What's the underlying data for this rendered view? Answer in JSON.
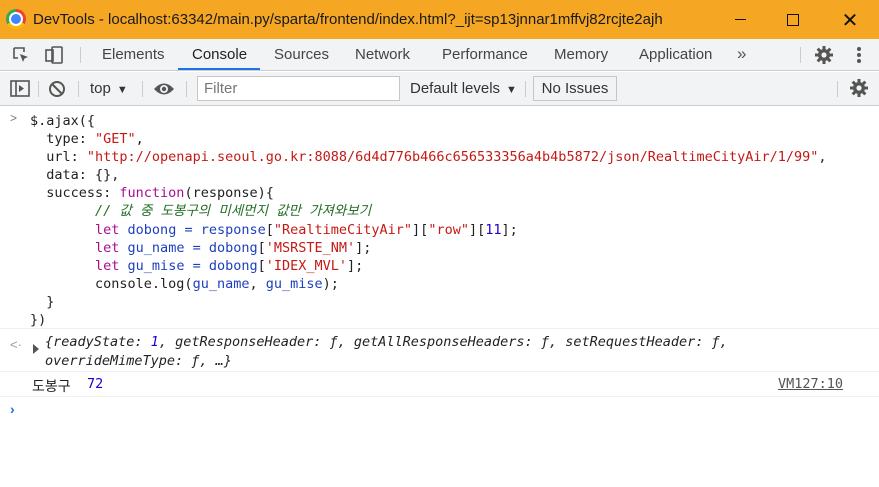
{
  "window": {
    "title": "DevTools - localhost:63342/main.py/sparta/frontend/index.html?_ijt=sp13jnnar1mffvj82rcjte2ajh",
    "accent_color": "#f5a623"
  },
  "tabs": {
    "items": [
      {
        "label": "Elements"
      },
      {
        "label": "Console"
      },
      {
        "label": "Sources"
      },
      {
        "label": "Network"
      },
      {
        "label": "Performance"
      },
      {
        "label": "Memory"
      },
      {
        "label": "Application"
      }
    ],
    "active": "Console",
    "more": "»"
  },
  "toolbar": {
    "context": "top",
    "filter_placeholder": "Filter",
    "levels": "Default levels",
    "issues": "No Issues"
  },
  "console": {
    "code": {
      "line1": "$.ajax({",
      "type_key": "  type: ",
      "type_val": "\"GET\"",
      "url_key": "  url: ",
      "url_val": "\"http://openapi.seoul.go.kr:8088/6d4d776b466c656533356a4b4b5872/json/RealtimeCityAir/1/99\"",
      "data_line": "  data: {},",
      "success_key": "  success: ",
      "success_fn": "function",
      "success_param": "(response){",
      "comment": "// 값 중 도봉구의 미세먼지 값만 가져와보기",
      "l1_kw": "let",
      "l1_var": " dobong = ",
      "l1_ref": "response",
      "l1_s1": "\"RealtimeCityAir\"",
      "l1_s2": "\"row\"",
      "l1_idx": "11",
      "l2_kw": "let",
      "l2_var": " gu_name = ",
      "l2_ref": "dobong",
      "l2_s": "'MSRSTE_NM'",
      "l3_kw": "let",
      "l3_var": " gu_mise = ",
      "l3_ref": "dobong",
      "l3_s": "'IDEX_MVL'",
      "l4": "console.log(",
      "l4_a": "gu_name",
      "l4_b": "gu_mise",
      "close_fn": "  }",
      "close_call": "})"
    },
    "result": {
      "part1": "{readyState: ",
      "ready_state": "1",
      "part2": ", getResponseHeader: ƒ, getAllResponseHeaders: ƒ, setRequestHeader: ƒ, overrideMimeType: ƒ, …}"
    },
    "log": {
      "text": "도봉구",
      "value": "72",
      "source": "VM127:10"
    },
    "prompt": "›"
  }
}
